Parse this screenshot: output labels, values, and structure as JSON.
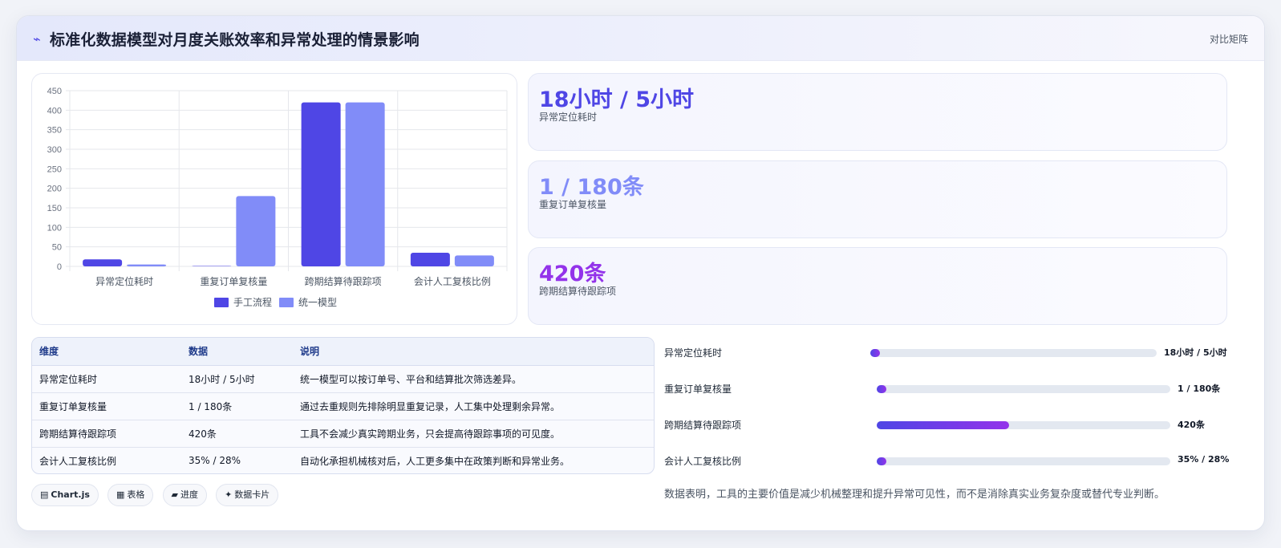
{
  "header": {
    "icon": "lightning-icon",
    "title": "标准化数据模型对月度关账效率和异常处理的情景影响",
    "tab_label": "对比矩阵"
  },
  "chart_data": {
    "type": "bar",
    "categories": [
      "异常定位耗时",
      "重复订单复核量",
      "跨期结算待跟踪项",
      "会计人工复核比例"
    ],
    "series": [
      {
        "name": "手工流程",
        "values": [
          18,
          1,
          420,
          35
        ],
        "color": "#4f46e5"
      },
      {
        "name": "统一模型",
        "values": [
          5,
          180,
          420,
          28
        ],
        "color": "#818cf8"
      }
    ],
    "ylim": [
      0,
      450
    ],
    "yticks": [
      0,
      50,
      100,
      150,
      200,
      250,
      300,
      350,
      400,
      450
    ],
    "legend_position": "bottom",
    "grid": true
  },
  "stats": [
    {
      "value": "18小时 / 5小时",
      "label": "异常定位耗时",
      "color": "#4f46e5"
    },
    {
      "value": "1 / 180条",
      "label": "重复订单复核量",
      "color": "#818cf8"
    },
    {
      "value": "420条",
      "label": "跨期结算待跟踪项",
      "color": "#9333ea"
    }
  ],
  "table": {
    "headers": [
      "维度",
      "数据",
      "说明"
    ],
    "rows": [
      [
        "异常定位耗时",
        "18小时 / 5小时",
        "统一模型可以按订单号、平台和结算批次筛选差异。"
      ],
      [
        "重复订单复核量",
        "1 / 180条",
        "通过去重规则先排除明显重复记录，人工集中处理剩余异常。"
      ],
      [
        "跨期结算待跟踪项",
        "420条",
        "工具不会减少真实跨期业务，只会提高待跟踪事项的可见度。"
      ],
      [
        "会计人工复核比例",
        "35% / 28%",
        "自动化承担机械核对后，人工更多集中在政策判断和异常业务。"
      ]
    ]
  },
  "chips": [
    {
      "icon": "▤",
      "label": "Chart.js"
    },
    {
      "icon": "▦",
      "label": "表格"
    },
    {
      "icon": "▰",
      "label": "进度"
    },
    {
      "icon": "✦",
      "label": "数据卡片"
    }
  ],
  "progress": [
    {
      "label": "异常定位耗时",
      "value_text": "18小时 / 5小时",
      "fraction": 0.03
    },
    {
      "label": "重复订单复核量",
      "value_text": "1 / 180条",
      "fraction": 0.03
    },
    {
      "label": "跨期结算待跟踪项",
      "value_text": "420条",
      "fraction": 0.45
    },
    {
      "label": "会计人工复核比例",
      "value_text": "35% / 28%",
      "fraction": 0.03
    }
  ],
  "conclusion": "数据表明，工具的主要价值是减少机械整理和提升异常可见性，而不是消除真实业务复杂度或替代专业判断。"
}
